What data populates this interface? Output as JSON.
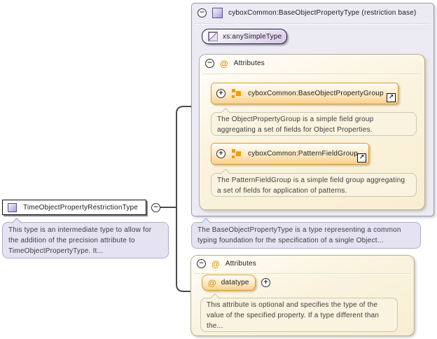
{
  "left_node": {
    "label": "TimeObjectPropertyRestrictionType",
    "description": "This type is an intermediate type to allow for the addition of the precision attribute to TimeObjectPropertyType. It..."
  },
  "base_container": {
    "title": "cyboxCommon:BaseObjectPropertyType (restriction base)",
    "simple_type": {
      "label": "xs:anySimpleType"
    },
    "attributes_section": {
      "title": "Attributes",
      "groups": [
        {
          "label": "cyboxCommon:BaseObjectPropertyGroup",
          "description": "The ObjectPropertyGroup is a simple field group aggregating a set of fields for Object Properties."
        },
        {
          "label": "cyboxCommon:PatternFieldGroup",
          "description": "The PatternFieldGroup is a simple field group aggregating a set of fields for application of patterns."
        }
      ]
    },
    "description": "The BaseObjectPropertyType is a type representing a common typing foundation for the specification of a single Object..."
  },
  "attributes_container": {
    "title": "Attributes",
    "attribute": {
      "label": "datatype",
      "description": "This attribute is optional and specifies the type of the value of the specified property. If a type different than the..."
    }
  },
  "glyphs": {
    "collapse": "−",
    "expand": "+",
    "attribute": "@",
    "link": "↗"
  },
  "colors": {
    "accent_orange": "#e0992b",
    "container_bg": "#ecebf4",
    "attributes_bg": "#fbf2db",
    "note_purple_bg": "#e5e3f2",
    "note_cream_bg": "#faf3e0"
  }
}
